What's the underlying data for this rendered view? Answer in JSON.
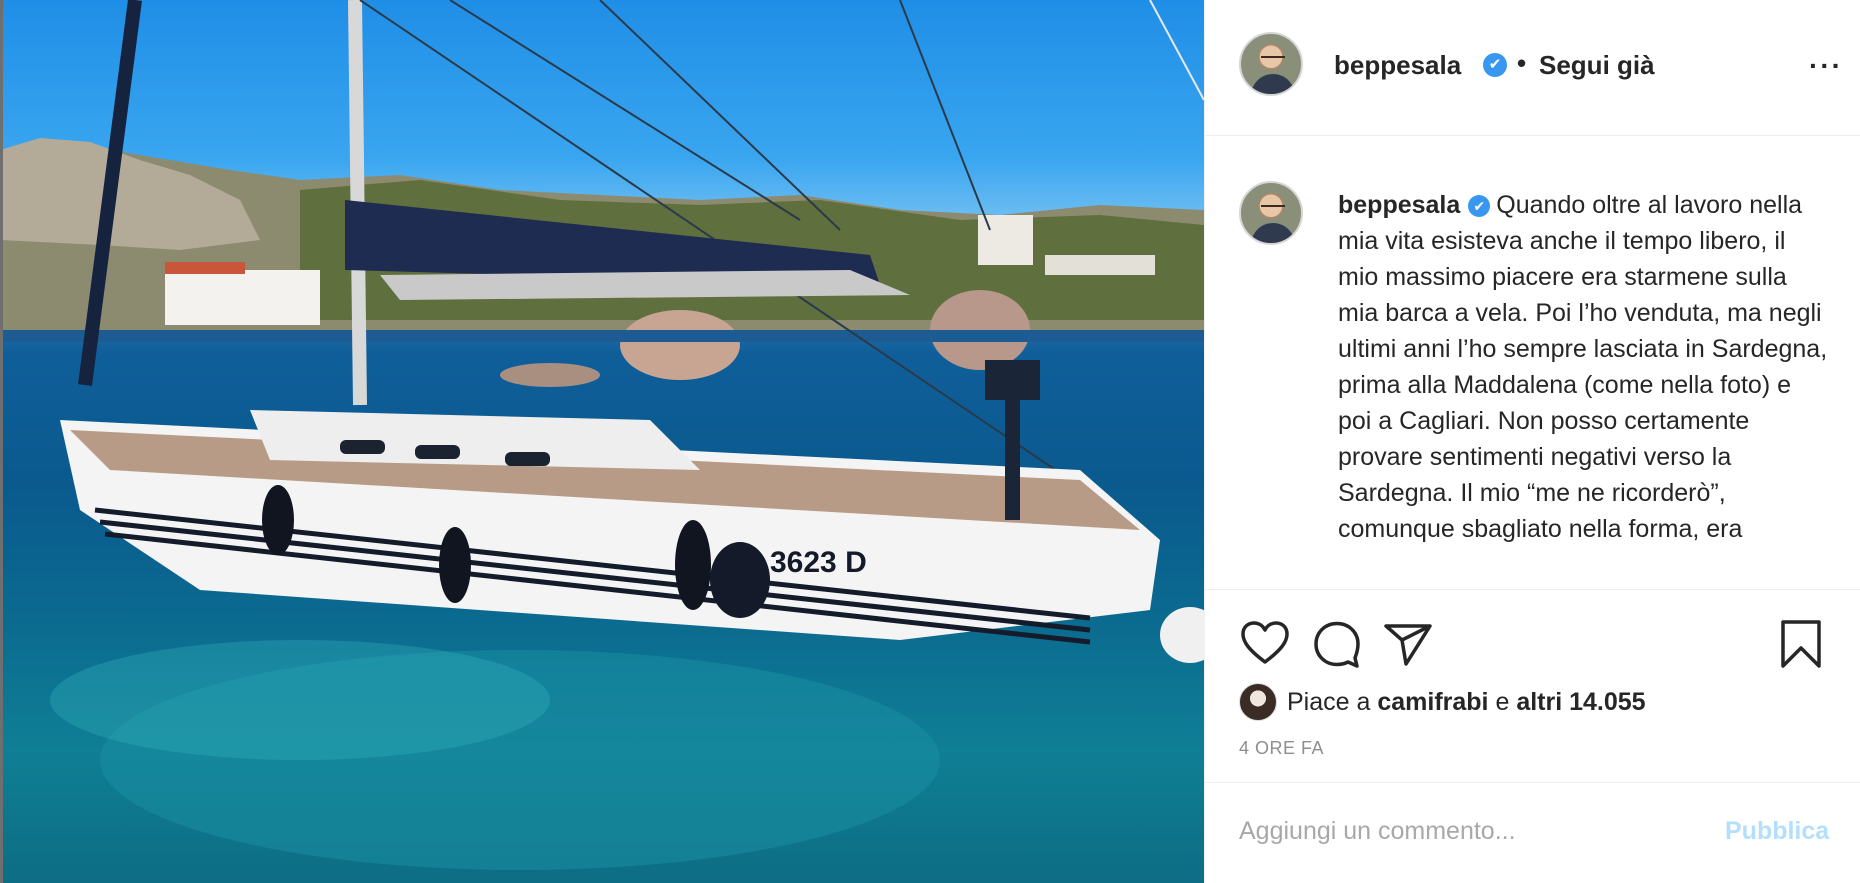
{
  "header": {
    "username": "beppesala",
    "verified_mark": "✔",
    "separator": "•",
    "follow_status": "Segui già",
    "more_label": "···"
  },
  "caption": {
    "username": "beppesala",
    "text": "Quando oltre al lavoro nella mia vita esisteva anche il tempo libero, il mio massimo piacere era starmene sulla mia barca a vela. Poi l’ho venduta, ma negli ultimi anni l’ho sempre lasciata in Sardegna, prima alla Maddalena (come nella foto) e poi a Cagliari. Non posso certamente provare sentimenti negativi verso la Sardegna. Il mio “me ne ricorderò”, comunque sbagliato nella forma, era"
  },
  "photo": {
    "hull_number": "N 3623 D"
  },
  "actions": {
    "icons": [
      "heart-icon",
      "comment-icon",
      "share-icon",
      "bookmark-icon"
    ]
  },
  "likes": {
    "prefix": "Piace a",
    "liker": "camifrabi",
    "connector": "e",
    "others": "altri 14.055"
  },
  "timestamp": "4 ORE FA",
  "comment": {
    "placeholder": "Aggiungi un commento...",
    "publish_label": "Pubblica"
  },
  "colors": {
    "verified": "#3897f0",
    "publish": "#b2dffc",
    "text": "#262626",
    "muted": "#8e8e8e"
  }
}
